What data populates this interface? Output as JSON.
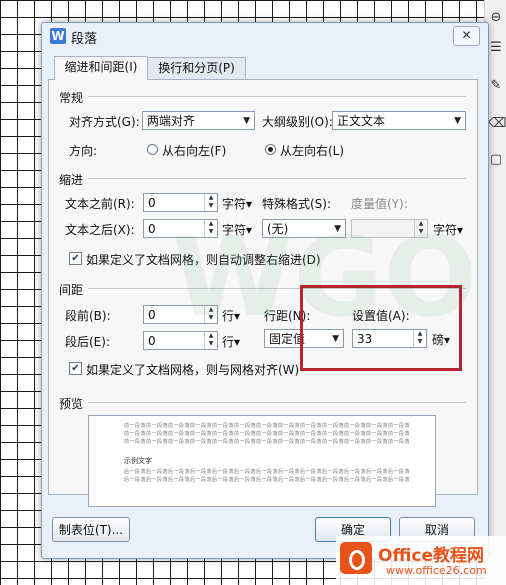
{
  "dialog": {
    "title": "段落",
    "app_icon_letter": "W",
    "close_label": "✕",
    "tabs": [
      {
        "label": "缩进和间距(I)",
        "active": true
      },
      {
        "label": "换行和分页(P)",
        "active": false
      }
    ]
  },
  "general": {
    "title": "常规",
    "alignment_label": "对齐方式(G):",
    "alignment_value": "两端对齐",
    "outline_label": "大纲级别(O):",
    "outline_value": "正文文本",
    "direction_label": "方向:",
    "direction_rtl": "从右向左(F)",
    "direction_ltr": "从左向右(L)",
    "direction_selected": "ltr"
  },
  "indent": {
    "title": "缩进",
    "before_label": "文本之前(R):",
    "before_value": "0",
    "before_unit": "字符▾",
    "after_label": "文本之后(X):",
    "after_value": "0",
    "after_unit": "字符▾",
    "special_label": "特殊格式(S):",
    "special_value": "(无)",
    "measure_label": "度量值(Y):",
    "measure_value": "",
    "measure_unit": "字符▾",
    "grid_checkbox": "如果定义了文档网格，则自动调整右缩进(D)",
    "grid_checked": true
  },
  "spacing": {
    "title": "间距",
    "before_label": "段前(B):",
    "before_value": "0",
    "before_unit": "行▾",
    "after_label": "段后(E):",
    "after_value": "0",
    "after_unit": "行▾",
    "line_label": "行距(N):",
    "line_value": "固定值",
    "set_label": "设置值(A):",
    "set_value": "33",
    "set_unit": "磅▾",
    "grid_checkbox": "如果定义了文档网格，则与网格对齐(W)",
    "grid_checked": true
  },
  "preview": {
    "title": "预览",
    "prev_line": "前一段落前一段落前一段落前一段落前一段落前一段落前一段落前一段落前一段落前一段落前一段落前一段落前一段落",
    "sample_text": "示例文字",
    "next_line": "后一段落后一段落后一段落后一段落后一段落后一段落后一段落后一段落后一段落后一段落后一段落后一段落后一段落"
  },
  "buttons": {
    "tabs": "制表位(T)...",
    "ok": "确定",
    "cancel": "取消"
  },
  "watermark": "WGO",
  "brand": {
    "title": "Office教程网",
    "url": "www.office26.com"
  },
  "colors": {
    "highlight": "#b3262b",
    "brand": "#e8531b",
    "dialog_bg": "#eaf0f8"
  }
}
